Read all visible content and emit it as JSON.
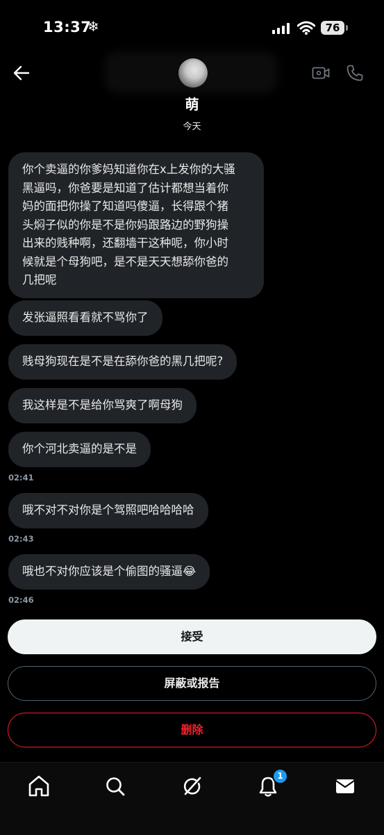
{
  "status_bar": {
    "time": "13:37",
    "battery": "76"
  },
  "header": {
    "name": "萌",
    "date_label": "今天"
  },
  "messages": [
    {
      "text": "你个卖逼的你爹妈知道你在x上发你的大骚\n黑逼吗，你爸要是知道了估计都想当着你\n妈的面把你操了知道吗傻逼，长得跟个猪\n头焖子似的你是不是你妈跟路边的野狗操\n出来的贱种啊，还翻墙干这种呢，你小时\n候就是个母狗吧，是不是天天想舔你爸的\n几把呢",
      "time": ""
    },
    {
      "text": "发张逼照看看就不骂你了",
      "time": ""
    },
    {
      "text": "贱母狗现在是不是在舔你爸的黑几把呢?",
      "time": ""
    },
    {
      "text": "我这样是不是给你骂爽了啊母狗",
      "time": ""
    },
    {
      "text": "你个河北卖逼的是不是",
      "time": "02:41"
    },
    {
      "text": "哦不对不对你是个驾照吧哈哈哈哈",
      "time": "02:43"
    },
    {
      "text": "哦也不对你应该是个偷图的骚逼😂",
      "time": "02:46"
    }
  ],
  "actions": {
    "accept": "接受",
    "block_report": "屏蔽或报告",
    "delete": "删除"
  },
  "nav": {
    "notifications_badge": "1"
  },
  "colors": {
    "accent": "#1d9bf0",
    "danger": "#f4212e",
    "bubble": "#202327"
  }
}
